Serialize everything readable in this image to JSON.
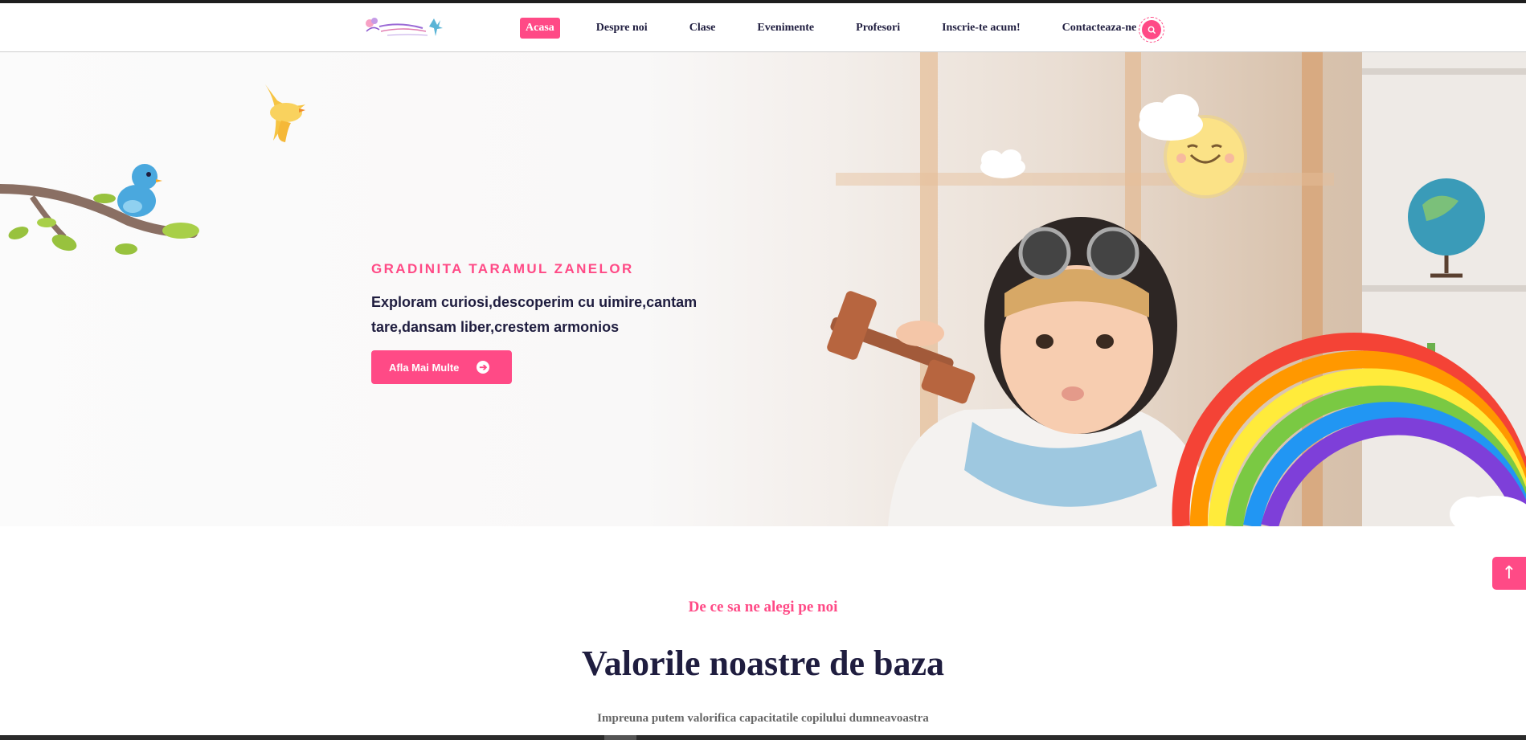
{
  "brand": {
    "logo_alt": "Taramul Zanelor",
    "accent": "#ff4a86",
    "dark": "#1f1d3f"
  },
  "nav": {
    "items": [
      {
        "label": "Acasa",
        "active": true
      },
      {
        "label": "Despre noi"
      },
      {
        "label": "Clase"
      },
      {
        "label": "Evenimente"
      },
      {
        "label": "Profesori"
      },
      {
        "label": "Inscrie-te acum!"
      },
      {
        "label": "Contacteaza-ne"
      }
    ],
    "search_icon": "search-icon"
  },
  "hero": {
    "eyebrow": "GRADINITA TARAMUL ZANELOR",
    "text": "Exploram curiosi,descoperim cu uimire,cantam tare,dansam liber,crestem armonios",
    "button_label": "Afla Mai Multe",
    "button_icon": "arrow-right-circle-icon"
  },
  "values": {
    "eyebrow": "De ce sa ne alegi pe noi",
    "title": "Valorile noastre de baza",
    "subtitle": "Impreuna putem valorifica capacitatile copilului dumneavoastra"
  },
  "scroll_top": {
    "label": "↑"
  }
}
